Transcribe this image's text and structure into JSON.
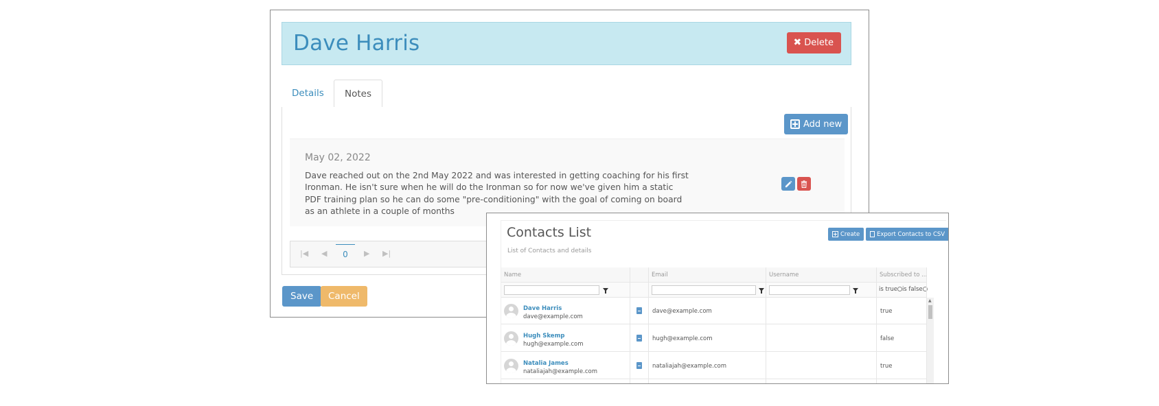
{
  "detail": {
    "title": "Dave Harris",
    "delete_label": "Delete",
    "tabs": [
      {
        "label": "Details",
        "active": false
      },
      {
        "label": "Notes",
        "active": true
      }
    ],
    "add_new_label": "Add new",
    "note": {
      "date": "May 02, 2022",
      "text": "Dave reached out on the 2nd May 2022 and was interested in getting coaching for his first Ironman. He isn't sure when he will do the Ironman so for now we've given him a static PDF training plan so he can do some \"pre-conditioning\" with the goal of coming on board as an athlete in a couple of months"
    },
    "pager": {
      "current_page": "0",
      "first_icon": "first-page-icon",
      "prev_icon": "prev-page-icon",
      "next_icon": "next-page-icon",
      "last_icon": "last-page-icon"
    },
    "save_label": "Save",
    "cancel_label": "Cancel"
  },
  "contacts": {
    "title": "Contacts List",
    "subtitle": "List of Contacts and details",
    "create_label": "Create",
    "export_label": "Export Contacts to CSV",
    "columns": {
      "name": "Name",
      "email": "Email",
      "username": "Username",
      "subscribed": "Subscribed to ..."
    },
    "filter_true": "is true",
    "filter_false": "is false",
    "rows": [
      {
        "name": "Dave Harris",
        "sub_email": "dave@example.com",
        "email": "dave@example.com",
        "username": "",
        "subscribed": "true"
      },
      {
        "name": "Hugh Skemp",
        "sub_email": "hugh@example.com",
        "email": "hugh@example.com",
        "username": "",
        "subscribed": "false"
      },
      {
        "name": "Natalia James",
        "sub_email": "nataliajah@example.com",
        "email": "nataliajah@example.com",
        "username": "",
        "subscribed": "true"
      }
    ]
  },
  "colors": {
    "primary": "#5b96c9",
    "danger": "#d9534f",
    "warning": "#efb96a",
    "header_bg": "#c7e9f1",
    "link": "#3c8dbc"
  }
}
